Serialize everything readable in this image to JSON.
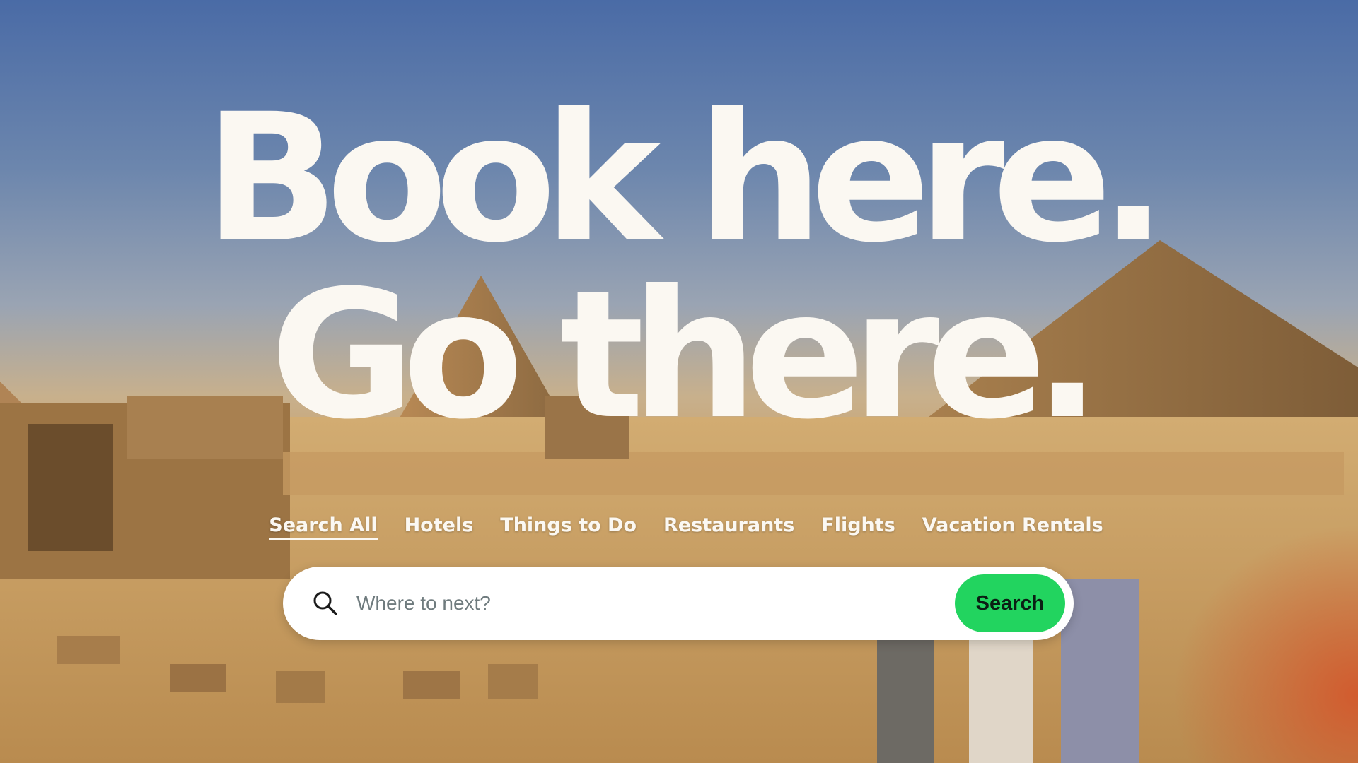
{
  "hero": {
    "line1": "Book here.",
    "line2": "Go there."
  },
  "tabs": [
    {
      "label": "Search All",
      "active": true
    },
    {
      "label": "Hotels",
      "active": false
    },
    {
      "label": "Things to Do",
      "active": false
    },
    {
      "label": "Restaurants",
      "active": false
    },
    {
      "label": "Flights",
      "active": false
    },
    {
      "label": "Vacation Rentals",
      "active": false
    }
  ],
  "search": {
    "placeholder": "Where to next?",
    "button_label": "Search",
    "icon": "search-icon"
  },
  "colors": {
    "headline": "#fbf8f2",
    "search_button": "#22d45f",
    "sky": "#4a6ba6",
    "sand": "#c99858"
  }
}
